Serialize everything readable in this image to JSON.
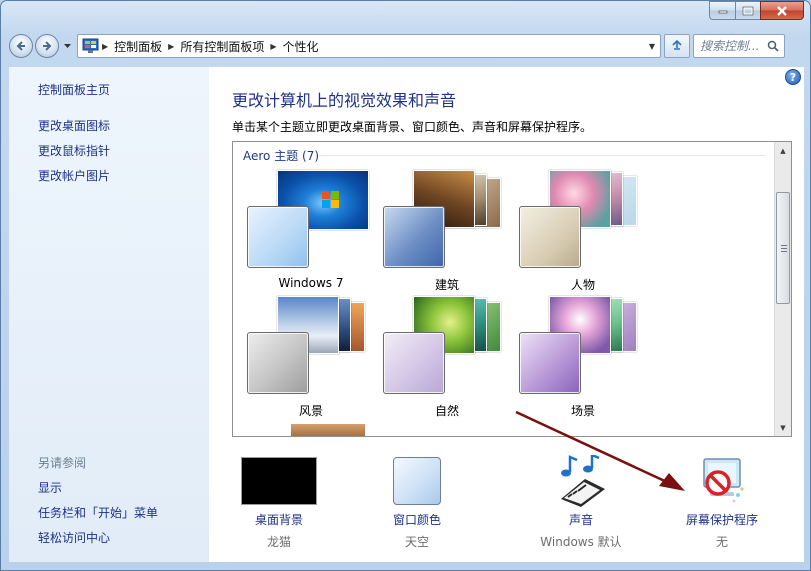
{
  "window": {
    "min_icon": "minimize-icon",
    "max_icon": "maximize-icon",
    "close_icon": "close-icon"
  },
  "nav": {
    "crumbs": [
      "控制面板",
      "所有控制面板项",
      "个性化"
    ],
    "search_placeholder": "搜索控制...",
    "back_icon": "back-arrow-icon",
    "forward_icon": "forward-arrow-icon",
    "refresh_icon": "refresh-icon",
    "search_icon": "search-icon"
  },
  "sidebar": {
    "home": "控制面板主页",
    "links": [
      "更改桌面图标",
      "更改鼠标指针",
      "更改帐户图片"
    ],
    "see_also": "另请参阅",
    "see_also_links": [
      "显示",
      "任务栏和「开始」菜单",
      "轻松访问中心"
    ]
  },
  "main": {
    "heading": "更改计算机上的视觉效果和声音",
    "description": "单击某个主题立即更改桌面背景、窗口颜色、声音和屏幕保护程序。",
    "group_header": "Aero 主题 (7)",
    "themes": [
      {
        "name": "Windows 7"
      },
      {
        "name": "建筑"
      },
      {
        "name": "人物"
      },
      {
        "name": "风景"
      },
      {
        "name": "自然"
      },
      {
        "name": "场景"
      }
    ],
    "settings": [
      {
        "label": "桌面背景",
        "value": "龙猫",
        "icon": "desktop-background-icon"
      },
      {
        "label": "窗口颜色",
        "value": "天空",
        "icon": "window-color-icon"
      },
      {
        "label": "声音",
        "value": "Windows 默认",
        "icon": "sound-icon"
      },
      {
        "label": "屏幕保护程序",
        "value": "无",
        "icon": "screensaver-icon"
      }
    ]
  },
  "colors": {
    "link": "#1e3287",
    "annotation_arrow": "#7a1010"
  }
}
